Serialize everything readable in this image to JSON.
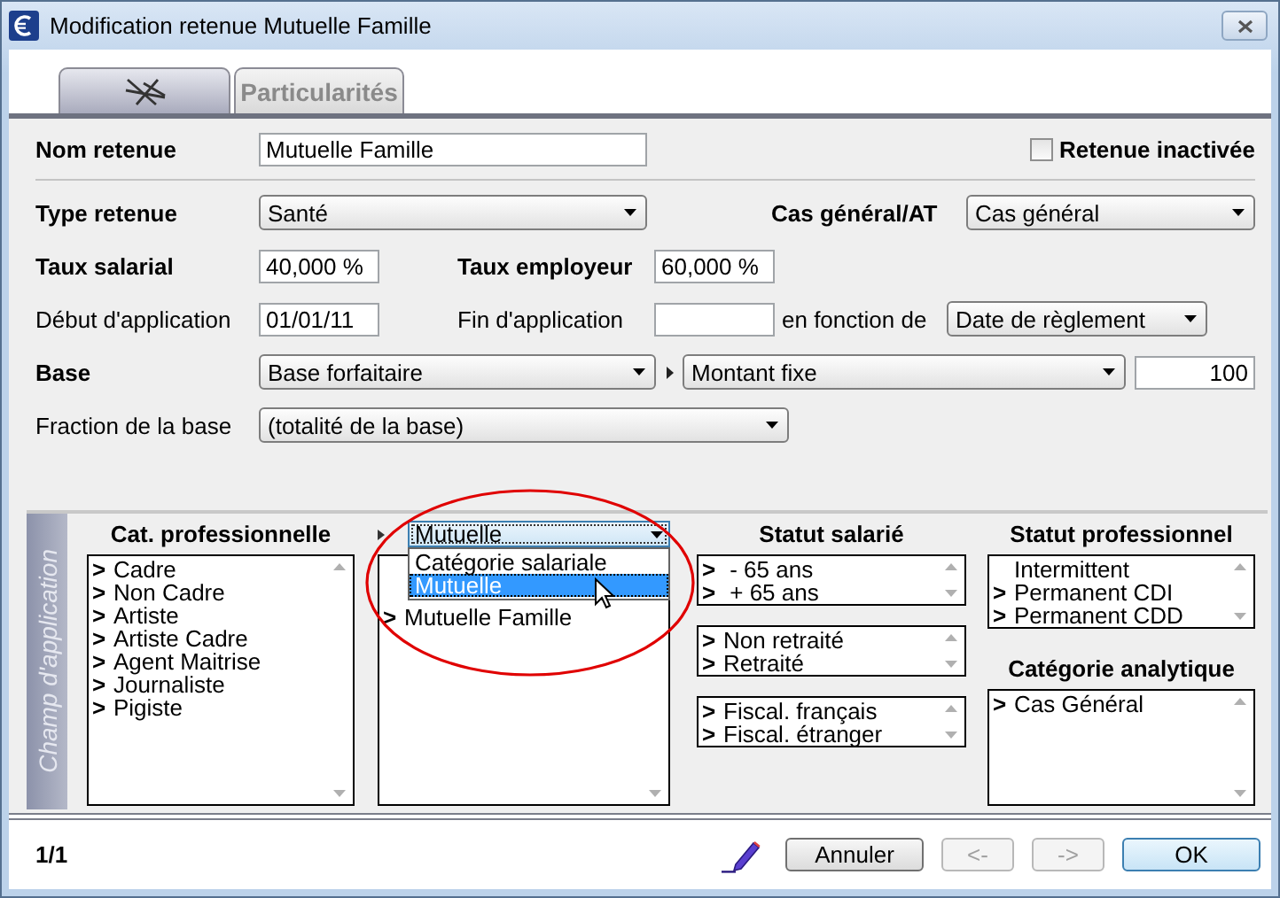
{
  "window": {
    "title": "Modification retenue Mutuelle Famille"
  },
  "tabs": [
    {
      "kind": "icon",
      "selected": true
    },
    {
      "kind": "text",
      "label": "Particularités",
      "selected": false
    }
  ],
  "form": {
    "nom_retenue": {
      "label": "Nom retenue",
      "emphasis": true,
      "value": "Mutuelle Famille"
    },
    "inactive": {
      "label": "Retenue inactivée",
      "checked": false
    },
    "type_retenue": {
      "label": "Type retenue",
      "emphasis": true,
      "value": "Santé"
    },
    "cas": {
      "label": "Cas général/AT",
      "emphasis": true,
      "value": "Cas général"
    },
    "taux_salarial": {
      "label": "Taux salarial",
      "emphasis": true,
      "value": "40,000 %"
    },
    "taux_employeur": {
      "label": "Taux employeur",
      "emphasis": true,
      "value": "60,000 %"
    },
    "debut": {
      "label": "Début d'application",
      "emphasis": false,
      "value": "01/01/11"
    },
    "fin": {
      "label": "Fin d'application",
      "emphasis": false
    },
    "en_fonction": {
      "label": "en fonction de",
      "emphasis": false,
      "value": "Date de règlement"
    },
    "base": {
      "label": "Base",
      "emphasis": true,
      "value": "Base forfaitaire",
      "mode": "Montant fixe",
      "amount": "100"
    },
    "fraction": {
      "label": "Fraction de la base",
      "emphasis": false,
      "value": "(totalité de la base)"
    }
  },
  "champ": {
    "title": "Champ d'application",
    "columns": [
      {
        "blocks": [
          {
            "kind": "header",
            "text": "Cat. professionnelle"
          },
          {
            "kind": "tall_list",
            "items": [
              {
                "marker": ">",
                "label": "Cadre"
              },
              {
                "marker": ">",
                "label": "Non Cadre"
              },
              {
                "marker": ">",
                "label": "Artiste"
              },
              {
                "marker": ">",
                "label": "Artiste Cadre"
              },
              {
                "marker": ">",
                "label": "Agent Maitrise"
              },
              {
                "marker": ">",
                "label": "Journaliste"
              },
              {
                "marker": ">",
                "label": "Pigiste"
              }
            ]
          }
        ]
      },
      {
        "blocks": [
          {
            "kind": "selector",
            "value": "Mutuelle",
            "expanded": true,
            "options": [
              {
                "label": "Catégorie salariale",
                "selected": false
              },
              {
                "label": "Mutuelle",
                "selected": true
              }
            ]
          },
          {
            "kind": "tall_list",
            "items": [
              {
                "marker": ">",
                "label": "Mutuelle Famille"
              }
            ]
          }
        ]
      },
      {
        "blocks": [
          {
            "kind": "header",
            "text": "Statut salarié"
          },
          {
            "kind": "list",
            "items": [
              {
                "marker": ">",
                "label": " - 65 ans"
              },
              {
                "marker": ">",
                "label": " + 65 ans"
              }
            ]
          },
          {
            "kind": "list",
            "items": [
              {
                "marker": ">",
                "label": "Non retraité"
              },
              {
                "marker": ">",
                "label": "Retraité"
              }
            ]
          },
          {
            "kind": "list",
            "items": [
              {
                "marker": ">",
                "label": "Fiscal. français"
              },
              {
                "marker": ">",
                "label": "Fiscal. étranger"
              }
            ]
          }
        ]
      },
      {
        "blocks": [
          {
            "kind": "header",
            "text": "Statut professionnel"
          },
          {
            "kind": "list",
            "items": [
              {
                "label": "Intermittent"
              },
              {
                "marker": ">",
                "label": "Permanent CDI"
              },
              {
                "marker": ">",
                "label": "Permanent CDD"
              }
            ]
          },
          {
            "kind": "header",
            "text": "Catégorie analytique"
          },
          {
            "kind": "tall_list",
            "items": [
              {
                "marker": ">",
                "label": "Cas Général"
              }
            ]
          }
        ]
      }
    ]
  },
  "footer": {
    "page": "1/1",
    "buttons": [
      {
        "label": "Annuler",
        "disabled": false,
        "default": false
      },
      {
        "label": "<-",
        "disabled": true,
        "default": false
      },
      {
        "label": "->",
        "disabled": true,
        "default": false
      },
      {
        "label": "OK",
        "disabled": false,
        "default": true
      }
    ]
  }
}
